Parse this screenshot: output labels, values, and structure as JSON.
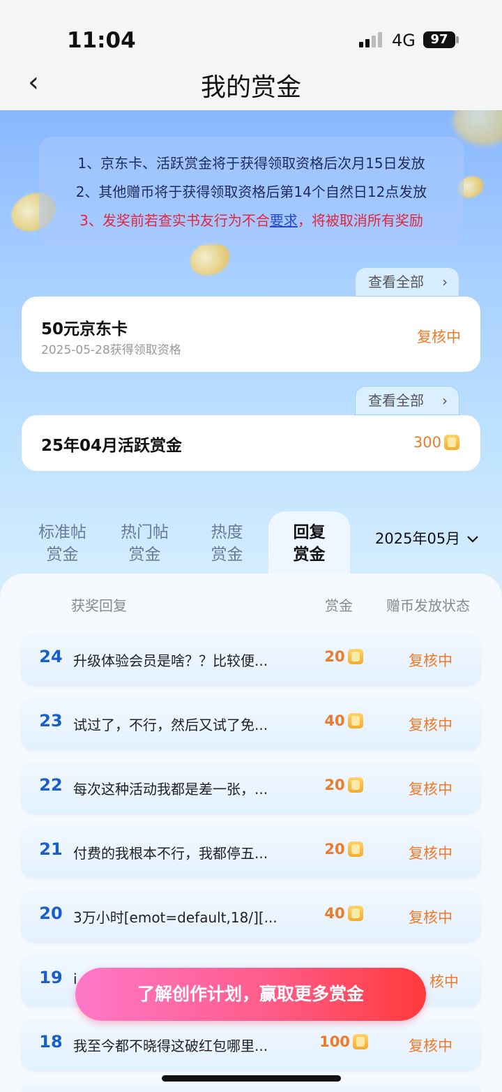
{
  "status_bar": {
    "time": "11:04",
    "network": "4G",
    "battery": "97"
  },
  "nav": {
    "title": "我的赏金"
  },
  "notice": {
    "line1": "1、京东卡、活跃赏金将于获得领取资格后次月15日发放",
    "line2": "2、其他赠币将于获得领取资格后第14个自然日12点发放",
    "line3_prefix": "3、发奖前若查实书友行为不合",
    "line3_link": "要求",
    "line3_suffix": "，将被取消所有奖励"
  },
  "reward_cards": [
    {
      "view_all": "查看全部",
      "title": "50元京东卡",
      "subtitle": "2025-05-28获得领取资格",
      "status": "复核中"
    },
    {
      "view_all": "查看全部",
      "title": "25年04月活跃赏金",
      "amount": "300"
    }
  ],
  "tabs": [
    {
      "line1": "标准帖",
      "line2": "赏金"
    },
    {
      "line1": "热门帖",
      "line2": "赏金"
    },
    {
      "line1": "热度",
      "line2": "赏金"
    },
    {
      "line1": "回复",
      "line2": "赏金"
    }
  ],
  "active_tab": 3,
  "month_selector": "2025年05月",
  "table_headers": {
    "reply": "获奖回复",
    "amount": "赏金",
    "status": "赠币发放状态"
  },
  "rows": [
    {
      "num": "24",
      "text": "升级体验会员是啥？？比较便...",
      "amount": "20",
      "status": "复核中"
    },
    {
      "num": "23",
      "text": "试过了，不行，然后又试了免...",
      "amount": "40",
      "status": "复核中"
    },
    {
      "num": "22",
      "text": "每次这种活动我都是差一张，...",
      "amount": "20",
      "status": "复核中"
    },
    {
      "num": "21",
      "text": "付费的我根本不行，我都停五...",
      "amount": "20",
      "status": "复核中"
    },
    {
      "num": "20",
      "text": "3万小时[emot=default,18/][...",
      "amount": "40",
      "status": "复核中"
    },
    {
      "num": "19",
      "text": "i",
      "amount": "",
      "status": "核中"
    },
    {
      "num": "18",
      "text": "我至今都不晓得这破红包哪里...",
      "amount": "100",
      "status": "复核中"
    }
  ],
  "cta": {
    "label": "了解创作计划，赢取更多赏金"
  },
  "colors": {
    "accent_orange": "#f07a2a",
    "number_blue": "#1a5fc9",
    "warning_red": "#e0273b"
  }
}
